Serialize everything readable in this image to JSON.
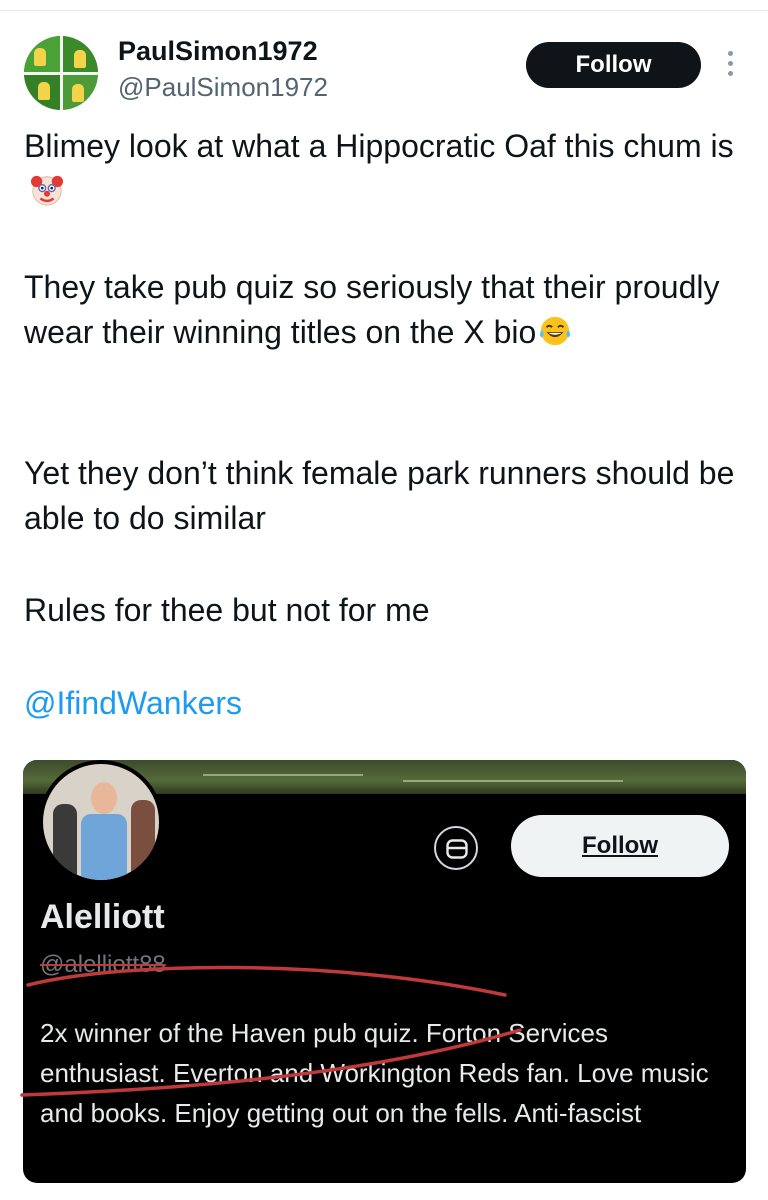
{
  "post": {
    "author": {
      "name": "PaulSimon1972",
      "handle": "@PaulSimon1972"
    },
    "follow_label": "Follow",
    "more_icon": "more-vertical-icon",
    "paragraphs": {
      "p1": "Blimey look at what a Hippocratic Oaf this chum is",
      "p2": "They take pub quiz so seriously that their proudly wear their winning titles on the X bio",
      "p3": "Yet they don’t think female park runners should be able to do similar",
      "p4": "Rules for thee but not for me"
    },
    "emojis": {
      "p1_end": "clown-face-emoji",
      "p2_end": "tears-of-joy-emoji"
    },
    "mention": "@IfindWankers",
    "link_color": "#1d9bf0"
  },
  "embedded_profile": {
    "name": "Alelliott",
    "handle": "@alelliott88",
    "follow_label": "Follow",
    "message_icon": "message-icon",
    "bio": "2x winner of the Haven pub quiz. Forton Services enthusiast. Everton and Workington Reds fan. Love music and books. Enjoy getting out on the fells. Anti-fascist",
    "annotation_color": "#c0393b"
  }
}
